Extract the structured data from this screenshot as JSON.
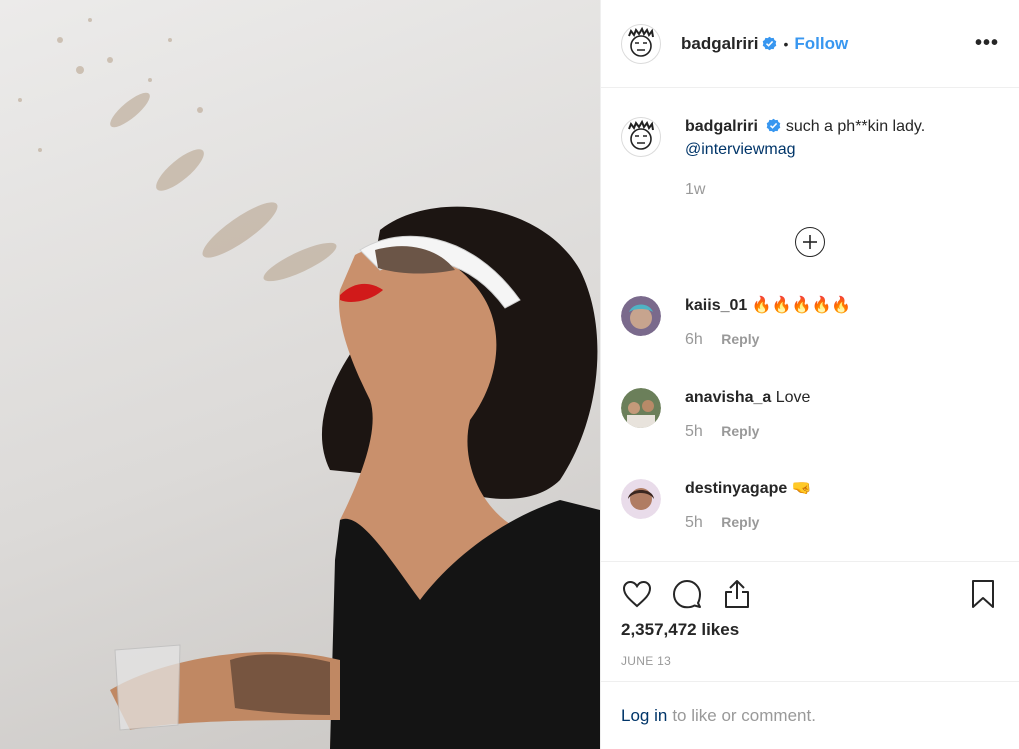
{
  "post": {
    "username": "badgalriri",
    "follow_label": "Follow",
    "dot": "•",
    "more": "•••"
  },
  "caption": {
    "username": "badgalriri",
    "text": "such a ph**kin lady.",
    "mention": "@interviewmag",
    "time": "1w"
  },
  "comments": [
    {
      "username": "kaiis_01",
      "text": "🔥🔥🔥🔥🔥",
      "time": "6h",
      "reply": "Reply"
    },
    {
      "username": "anavisha_a",
      "text": "Love",
      "time": "5h",
      "reply": "Reply"
    },
    {
      "username": "destinyagape",
      "text": "🤜",
      "time": "5h",
      "reply": "Reply"
    }
  ],
  "actions": {
    "likes": "2,357,472 likes",
    "date": "JUNE 13"
  },
  "login": {
    "link": "Log in",
    "text": "to like or comment."
  },
  "colors": {
    "link_blue": "#3897f0",
    "mention_blue": "#003569",
    "muted": "#999999"
  }
}
